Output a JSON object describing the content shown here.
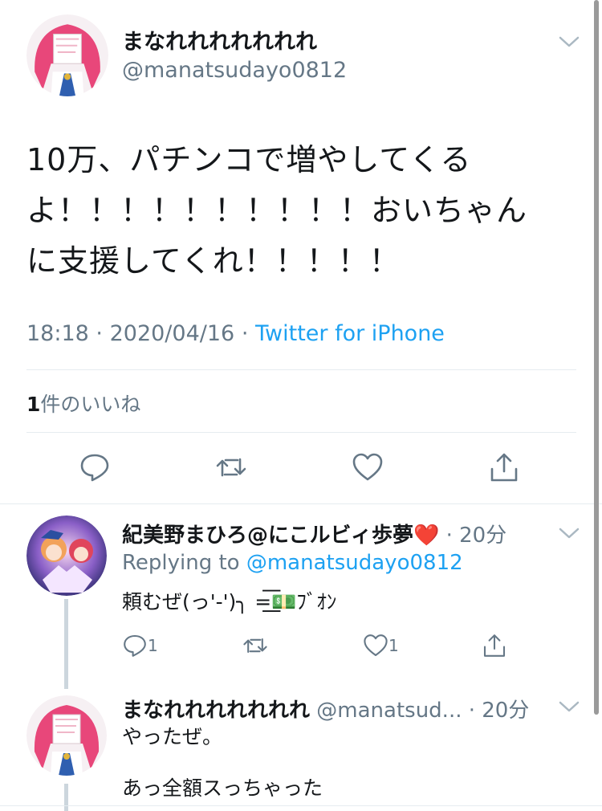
{
  "main_tweet": {
    "display_name": "まなれれれれれれれ",
    "handle": "@manatsudayo0812",
    "text_lines": [
      "10万、パチンコで増やしてくる",
      "よ！！！！！！！！！！おいちゃん",
      "に支援してくれ！！！！！"
    ],
    "time": "18:18",
    "date": "2020/04/16",
    "dot": "·",
    "source": "Twitter for iPhone",
    "likes_count": "1",
    "likes_label": "件のいいね"
  },
  "replies": [
    {
      "display_name": "紀美野まひろ@にこルビィ歩夢❤️",
      "time": "· 20分",
      "replying_prefix": "Replying to",
      "replying_handle": "@manatsudayo0812",
      "text": "頼むぜ(っ'-')╮ =͟͟͞͞💵ﾌﾞｵﾝ",
      "reply_count": "1",
      "like_count": "1"
    },
    {
      "display_name": "まなれれれれれれれ",
      "handle": "@manatsud...",
      "time": "· 20分",
      "text": "やったぜ。\n\nあっ全額スっちゃった"
    }
  ],
  "colors": {
    "accent": "#1da1f2",
    "secondary_text": "#657786",
    "divider": "#e6ecf0",
    "avatar_hair": "#e8477a"
  },
  "icons": [
    "chevron-down-icon",
    "reply-icon",
    "retweet-icon",
    "like-icon",
    "share-icon"
  ]
}
